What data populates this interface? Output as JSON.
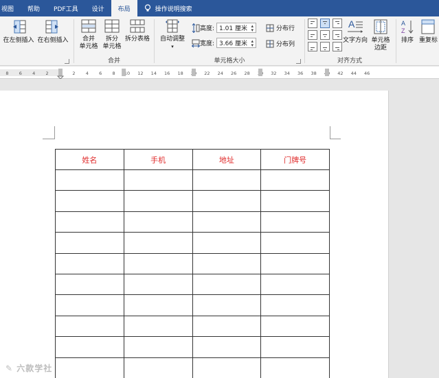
{
  "tabs": [
    {
      "label": "视图",
      "active": false
    },
    {
      "label": "帮助",
      "active": false
    },
    {
      "label": "PDF工具",
      "active": false
    },
    {
      "label": "设计",
      "active": false
    },
    {
      "label": "布局",
      "active": true
    },
    {
      "label": "操作说明搜索",
      "active": false
    }
  ],
  "ribbon": {
    "rows_cols": {
      "insert_left": "在左侧插入",
      "insert_right": "在右侧插入"
    },
    "merge": {
      "merge_cells_l1": "合并",
      "merge_cells_l2": "单元格",
      "split_cells_l1": "拆分",
      "split_cells_l2": "单元格",
      "split_table": "拆分表格",
      "group_label": "合并"
    },
    "cell_size": {
      "autofit": "自动调整",
      "height_label": "高度:",
      "height_value": "1.01 厘米",
      "width_label": "宽度:",
      "width_value": "3.66 厘米",
      "distribute_rows": "分布行",
      "distribute_cols": "分布列",
      "group_label": "单元格大小"
    },
    "alignment": {
      "text_direction": "文字方向",
      "cell_margins_l1": "单元格",
      "cell_margins_l2": "边距",
      "group_label": "对齐方式"
    },
    "data": {
      "sort": "排序",
      "repeat_header": "重复标"
    }
  },
  "ruler": {
    "left_labels": [
      "8",
      "6",
      "4",
      "2"
    ],
    "right_labels": [
      "2",
      "4",
      "6",
      "8",
      "10",
      "12",
      "14",
      "16",
      "18",
      "20",
      "22",
      "24",
      "26",
      "28",
      "30",
      "32",
      "34",
      "36",
      "38",
      "40",
      "42",
      "44",
      "46"
    ]
  },
  "table": {
    "headers": [
      "姓名",
      "手机",
      "地址",
      "门牌号"
    ],
    "empty_rows": 10
  },
  "watermark": "✎ 六款学社",
  "colors": {
    "tab_bar": "#2b579a",
    "header_text": "#e02b2b"
  }
}
